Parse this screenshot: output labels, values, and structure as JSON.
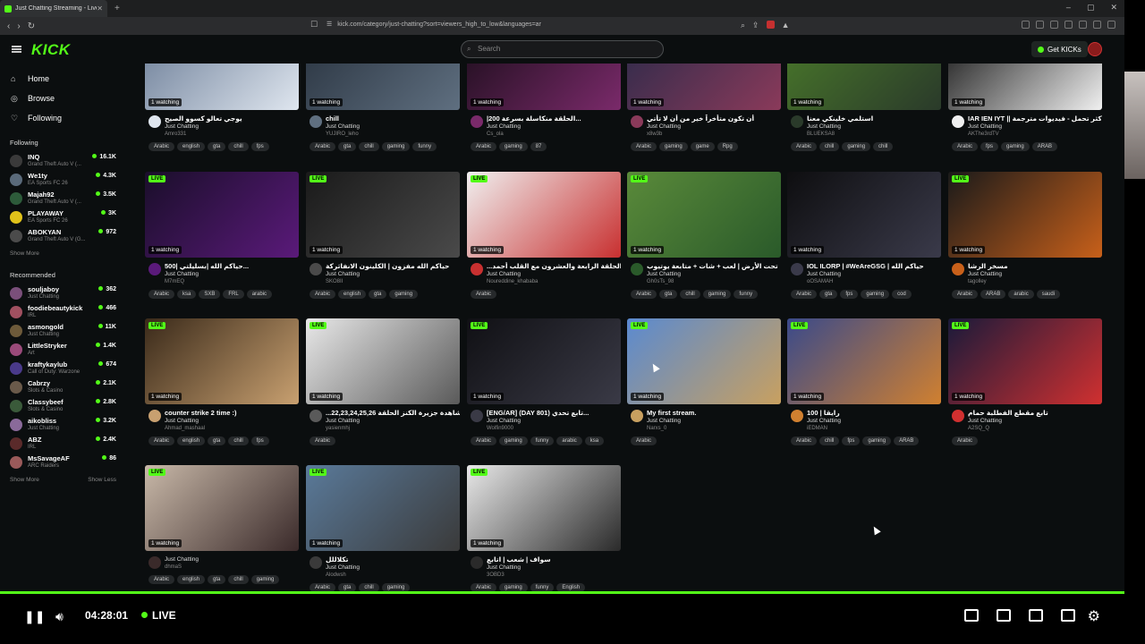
{
  "browser": {
    "tab_title": "Just Chatting Streaming - Live D",
    "url": "kick.com/category/just-chatting?sort=viewers_high_to_low&languages=ar"
  },
  "header": {
    "logo": "KICK",
    "search_placeholder": "Search",
    "get_kicks": "Get KICKs"
  },
  "nav": [
    {
      "label": "Home",
      "icon": "home-icon"
    },
    {
      "label": "Browse",
      "icon": "compass-icon"
    },
    {
      "label": "Following",
      "icon": "heart-icon"
    }
  ],
  "sidebar": {
    "following_title": "Following",
    "following": [
      {
        "name": "INQ",
        "game": "Grand Theft Auto V (...",
        "viewers": "16.1K",
        "color": "#3a3a3a"
      },
      {
        "name": "We1ty",
        "game": "EA Sports FC 26",
        "viewers": "4.3K",
        "color": "#5a6a7a"
      },
      {
        "name": "Majah92",
        "game": "Grand Theft Auto V (...",
        "viewers": "3.5K",
        "color": "#2d5b3a"
      },
      {
        "name": "PLAYAWAY",
        "game": "EA Sports FC 26",
        "viewers": "3K",
        "color": "#e0c21a"
      },
      {
        "name": "ABOKYAN",
        "game": "Grand Theft Auto V (G...",
        "viewers": "972",
        "color": "#4b4b4b"
      }
    ],
    "show_more_1": "Show More",
    "recommended_title": "Recommended",
    "recommended": [
      {
        "name": "souljaboy",
        "game": "Just Chatting",
        "viewers": "362",
        "color": "#7a4f7a"
      },
      {
        "name": "foodiebeautykick",
        "game": "IRL",
        "viewers": "466",
        "color": "#a05060"
      },
      {
        "name": "asmongold",
        "game": "Just Chatting",
        "viewers": "11K",
        "color": "#6d5a3a"
      },
      {
        "name": "LittleStryker",
        "game": "Art",
        "viewers": "1.4K",
        "color": "#9a4a7a"
      },
      {
        "name": "kraftykaylub",
        "game": "Call of Duty: Warzone",
        "viewers": "674",
        "color": "#4a3a8a"
      },
      {
        "name": "Cabrzy",
        "game": "Slots & Casino",
        "viewers": "2.1K",
        "color": "#6a5a4a"
      },
      {
        "name": "Classybeef",
        "game": "Slots & Casino",
        "viewers": "2.8K",
        "color": "#3a5a3a"
      },
      {
        "name": "aikobliss",
        "game": "Just Chatting",
        "viewers": "3.2K",
        "color": "#8a6a9a"
      },
      {
        "name": "ABZ",
        "game": "IRL",
        "viewers": "2.4K",
        "color": "#5a2a2a"
      },
      {
        "name": "MsSavageAF",
        "game": "ARC Raiders",
        "viewers": "86",
        "color": "#9a5a5a"
      }
    ],
    "show_more_2": "Show More",
    "show_less": "Show Less"
  },
  "streams": [
    {
      "title": "يوجي تعالو كسوو الصيح",
      "category": "Just Chatting",
      "user": "Amro331",
      "tags": [
        "Arabic",
        "english",
        "gta",
        "chill",
        "fps"
      ],
      "watching": "1 watching",
      "live": false,
      "colors": [
        "#6a7c96",
        "#dfe6ef"
      ]
    },
    {
      "title": "chill",
      "category": "Just Chatting",
      "user": "YUJIRO_leho",
      "tags": [
        "Arabic",
        "gta",
        "chill",
        "gaming",
        "funny"
      ],
      "watching": "1 watching",
      "live": false,
      "colors": [
        "#28323e",
        "#5f6f80"
      ]
    },
    {
      "title": "|200 الحلقة منكاسلة بسرعة...",
      "category": "Just Chatting",
      "user": "Cs_ola",
      "tags": [
        "Arabic",
        "gaming",
        "87"
      ],
      "watching": "1 watching",
      "live": false,
      "colors": [
        "#1a0d1a",
        "#7a2a6a"
      ]
    },
    {
      "title": "أن تكون متأخراً خير من أن لا تأتي",
      "category": "Just Chatting",
      "user": "x8w3b",
      "tags": [
        "Arabic",
        "gaming",
        "game",
        "Rpg"
      ],
      "watching": "1 watching",
      "live": false,
      "colors": [
        "#2a2a4a",
        "#8a3a5a"
      ]
    },
    {
      "title": "استلمي خلينكي معنا",
      "category": "Just Chatting",
      "user": "BLUEKSA8",
      "tags": [
        "Arabic",
        "chill",
        "gaming",
        "chill"
      ],
      "watching": "1 watching",
      "live": false,
      "colors": [
        "#4a7a2a",
        "#2a3a2a"
      ]
    },
    {
      "title": "IAR IEN IYT || الأكثر تحمل - فيديوات مترجمة",
      "category": "Just Chatting",
      "user": "AKThe3rdTV",
      "tags": [
        "Arabic",
        "fps",
        "gaming",
        "ARAB"
      ],
      "watching": "1 watching",
      "live": false,
      "colors": [
        "#111",
        "#f0f0f0"
      ]
    },
    {
      "title": "500| حياكم الله |بسليلتي...",
      "category": "Just Chatting",
      "user": "M7mEQ",
      "tags": [
        "Arabic",
        "ksa",
        "SXB",
        "FRL",
        "arabic"
      ],
      "watching": "1 watching",
      "live": true,
      "colors": [
        "#1a0e2a",
        "#5a1a7a"
      ]
    },
    {
      "title": "حياكم الله مفزون | الكلينون الانفاثركة",
      "category": "Just Chatting",
      "user": "SKO8II",
      "tags": [
        "Arabic",
        "english",
        "gta",
        "gaming"
      ],
      "watching": "1 watching",
      "live": true,
      "colors": [
        "#1a1a1a",
        "#4a4a4a"
      ]
    },
    {
      "title": "...د: الحلقة الرابعة والعشرون مع القلب أحمد...",
      "category": "Just Chatting",
      "user": "Noureddine_khababa",
      "tags": [
        "Arabic"
      ],
      "watching": "1 watching",
      "live": true,
      "colors": [
        "#f0f0f0",
        "#c83030"
      ]
    },
    {
      "title": "تحت الأرض | لعب + شات + متابعة يوتيوب",
      "category": "Just Chatting",
      "user": "Gh0sTs_98",
      "tags": [
        "Arabic",
        "gta",
        "chill",
        "gaming",
        "funny"
      ],
      "watching": "1 watching",
      "live": true,
      "colors": [
        "#5a8a3a",
        "#2a5a2a"
      ]
    },
    {
      "title": "IOL ILORP | #WeAreGSG | حياكم الله",
      "category": "Just Chatting",
      "user": "oOSAMAH",
      "tags": [
        "Arabic",
        "gta",
        "fps",
        "gaming",
        "cod"
      ],
      "watching": "1 watching",
      "live": false,
      "colors": [
        "#0e0e10",
        "#3a3a4a"
      ]
    },
    {
      "title": "مسخر الرشا",
      "category": "Just Chatting",
      "user": "tagolley",
      "tags": [
        "Arabic",
        "ARAB",
        "arabic",
        "saudi"
      ],
      "watching": "1 watching",
      "live": true,
      "colors": [
        "#1a1a1a",
        "#c8601a"
      ]
    },
    {
      "title": "counter strike 2 time :)",
      "category": "Just Chatting",
      "user": "Ahmad_mashaal",
      "tags": [
        "Arabic",
        "english",
        "gta",
        "chill",
        "fps"
      ],
      "watching": "1 watching",
      "live": true,
      "colors": [
        "#3a2a1a",
        "#c8a070"
      ]
    },
    {
      "title": "...مشاهدة جزيرة الكنز الحلقة 22,23,24,25,26",
      "category": "Just Chatting",
      "user": "yasienmhj",
      "tags": [
        "Arabic"
      ],
      "watching": "1 watching",
      "live": true,
      "colors": [
        "#e8e8e8",
        "#5a5a5a"
      ]
    },
    {
      "title": "[ENG/AR] (DAY 801) تابع تحدي...",
      "category": "Just Chatting",
      "user": "Wolfin9000",
      "tags": [
        "Arabic",
        "gaming",
        "funny",
        "arabic",
        "ksa"
      ],
      "watching": "1 watching",
      "live": true,
      "colors": [
        "#101014",
        "#3a3a46"
      ]
    },
    {
      "title": "My first stream.",
      "category": "Just Chatting",
      "user": "Narxs_0",
      "tags": [
        "Arabic"
      ],
      "watching": "1 watching",
      "live": true,
      "colors": [
        "#5a8ad0",
        "#c8a060"
      ]
    },
    {
      "title": "100 | رايقا",
      "category": "Just Chatting",
      "user": "iEDMAN",
      "tags": [
        "Arabic",
        "chill",
        "fps",
        "gaming",
        "ARAB"
      ],
      "watching": "1 watching",
      "live": true,
      "colors": [
        "#3a4a8a",
        "#d08030"
      ]
    },
    {
      "title": "تابع مقطع الفطلبة حمام",
      "category": "Just Chatting",
      "user": "A2SQ_Q",
      "tags": [
        "Arabic"
      ],
      "watching": "1 watching",
      "live": true,
      "colors": [
        "#1a1a3a",
        "#d03030"
      ]
    },
    {
      "title": "",
      "category": "Just Chatting",
      "user": "dhmaS",
      "tags": [
        "Arabic",
        "english",
        "gta",
        "chill",
        "gaming"
      ],
      "watching": "1 watching",
      "live": true,
      "colors": [
        "#c8b8a8",
        "#3a2a2a"
      ]
    },
    {
      "title": "تكلاللل",
      "category": "Just Chatting",
      "user": "Alodwsh",
      "tags": [
        "Arabic",
        "gta",
        "chill",
        "gaming"
      ],
      "watching": "1 watching",
      "live": true,
      "colors": [
        "#5a7a9a",
        "#3a3a3a"
      ]
    },
    {
      "title": "سواف | شعب | اتابع",
      "category": "Just Chatting",
      "user": "3OBD3",
      "tags": [
        "Arabic",
        "gaming",
        "funny",
        "English"
      ],
      "watching": "1 watching",
      "live": true,
      "colors": [
        "#e8e8e8",
        "#2a2a2a"
      ]
    }
  ],
  "player": {
    "time": "04:28:01",
    "live_label": "LIVE",
    "progress": 1.0
  }
}
